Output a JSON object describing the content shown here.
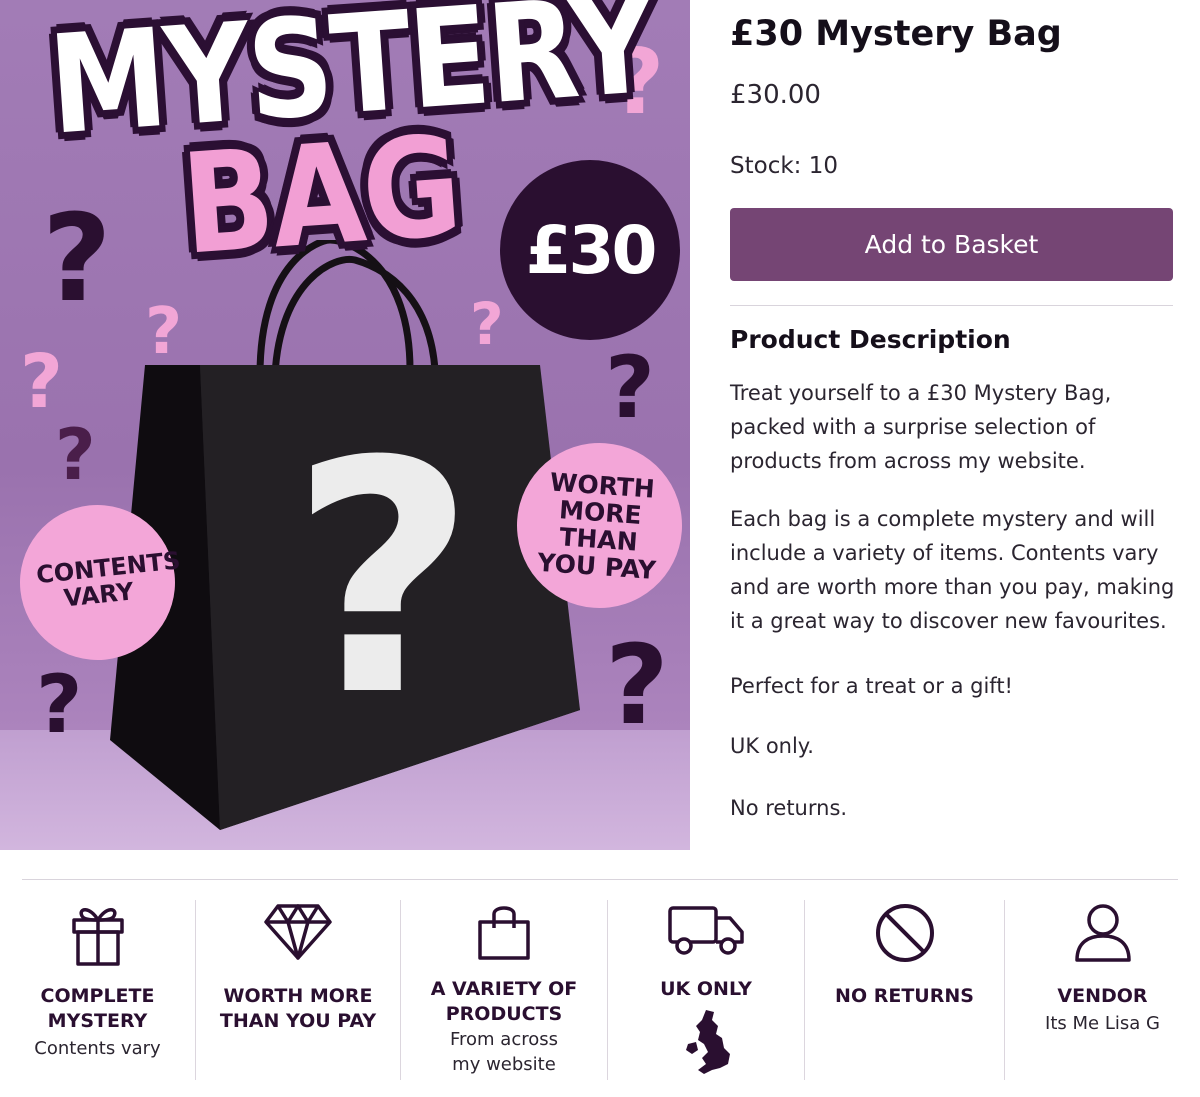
{
  "image": {
    "headline_line1": "MYSTERY",
    "headline_line2": "BAG",
    "price_badge": "£30",
    "sticker_left": "CONTENTS VARY",
    "sticker_right": "WORTH MORE THAN YOU PAY",
    "bag_symbol": "?",
    "colors": {
      "background": "#9a72ae",
      "pink": "#f29fd4",
      "dark": "#2a0f30"
    }
  },
  "product": {
    "title": "£30 Mystery Bag",
    "price": "£30.00",
    "stock": "Stock: 10",
    "add_to_basket": "Add to Basket"
  },
  "description": {
    "heading": "Product Description",
    "paragraphs": [
      "Treat yourself to a £30 Mystery Bag, packed with a surprise selection of products from across my website.",
      "Each bag is a complete mystery and will include a variety of items. Contents vary and are worth more than you pay, making it a great way to discover new favourites.",
      "Perfect for a treat or a gift!",
      "UK only.",
      "No returns."
    ]
  },
  "features": [
    {
      "icon": "gift-icon",
      "title": "COMPLETE MYSTERY",
      "subtitle": "Contents vary"
    },
    {
      "icon": "diamond-icon",
      "title": "WORTH MORE THAN YOU PAY",
      "subtitle": ""
    },
    {
      "icon": "shopping-bag-icon",
      "title": "A VARIETY OF PRODUCTS",
      "subtitle": "From across my website"
    },
    {
      "icon": "delivery-van-icon",
      "title": "UK ONLY",
      "subtitle": ""
    },
    {
      "icon": "no-entry-icon",
      "title": "NO RETURNS",
      "subtitle": ""
    },
    {
      "icon": "user-icon",
      "title": "VENDOR",
      "subtitle": "Its Me Lisa G"
    }
  ],
  "colors": {
    "accent": "#754574",
    "text": "#150f1a",
    "icon": "#2a0f30"
  }
}
